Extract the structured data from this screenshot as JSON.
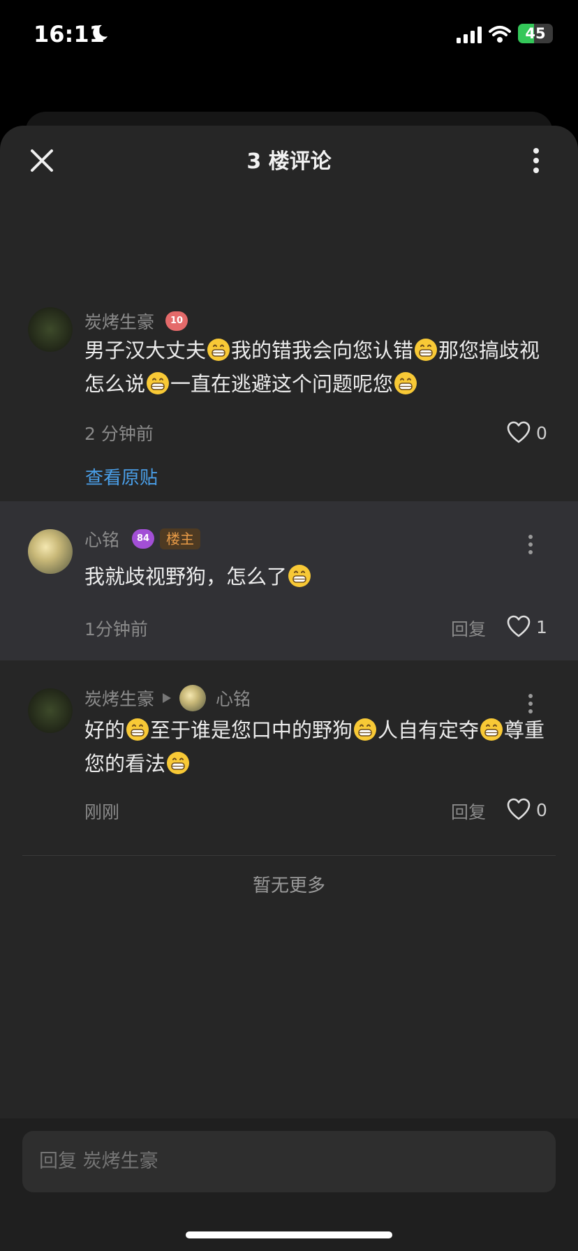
{
  "status": {
    "time": "16:11",
    "battery": "45",
    "battery_level": 0.45
  },
  "header": {
    "title": "3 楼评论"
  },
  "comments": [
    {
      "username": "炭烤生豪",
      "level": "10",
      "content_parts": [
        "男子汉大丈夫",
        "我的错我会向您认错",
        "那您搞歧视怎么说",
        "一直在逃避这个问题呢您"
      ],
      "time": "2 分钟前",
      "likes": "0",
      "view_post": "查看原贴"
    },
    {
      "username": "心铭",
      "level": "84",
      "host_badge": "楼主",
      "content_parts": [
        "我就歧视野狗，怎么了"
      ],
      "time": "1分钟前",
      "reply": "回复",
      "likes": "1"
    },
    {
      "username": "炭烤生豪",
      "reply_to": "心铭",
      "content_parts": [
        "好的",
        "至于谁是您口中的野狗",
        "人自有定夺",
        "尊重您的看法"
      ],
      "time": "刚刚",
      "reply": "回复",
      "likes": "0"
    }
  ],
  "no_more": "暂无更多",
  "reply_input": {
    "placeholder": "回复 炭烤生豪"
  },
  "icons": {
    "close": "close-icon",
    "more": "more-vertical-icon",
    "heart": "heart-outline-icon",
    "emoji": "grinning-face-emoji",
    "moon": "moon-icon",
    "signal": "signal-icon",
    "wifi": "wifi-icon"
  },
  "colors": {
    "link": "#4a9fe8",
    "host_badge": "#e79a47",
    "battery": "#34c759"
  }
}
